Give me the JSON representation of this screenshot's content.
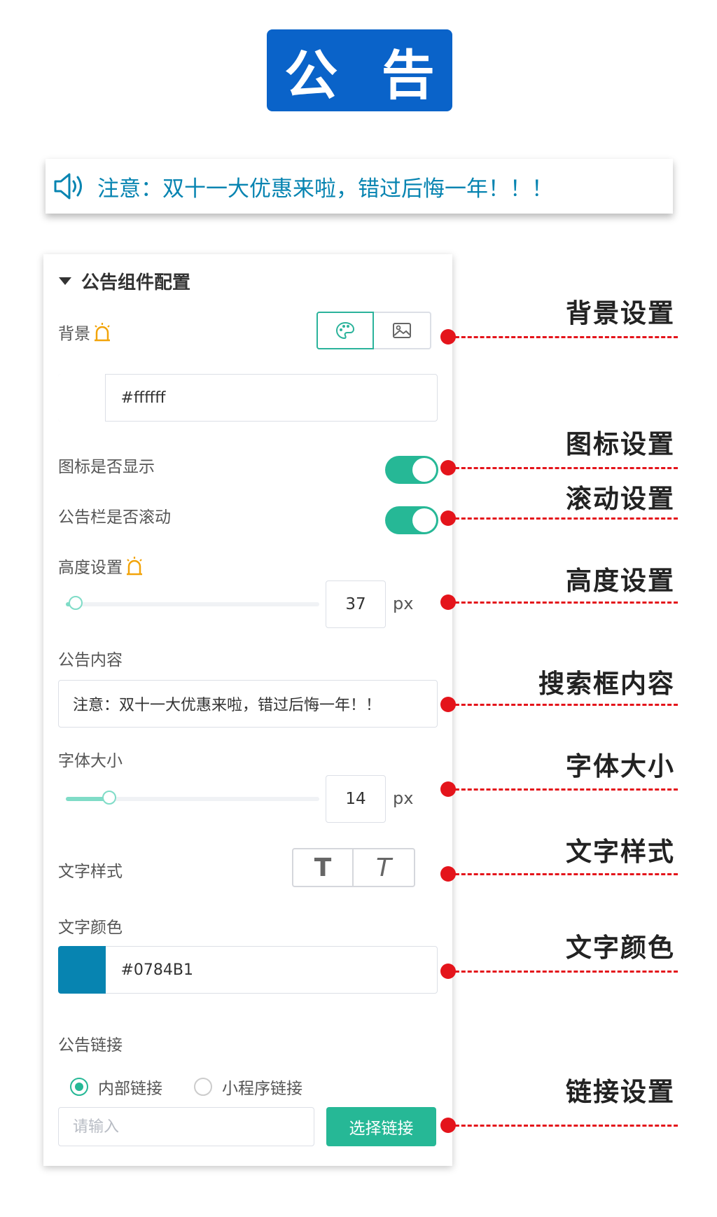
{
  "header": {
    "title": "公 告"
  },
  "notice": {
    "text": "注意：双十一大优惠来啦，错过后悔一年！！！"
  },
  "panel": {
    "title": "公告组件配置",
    "background": {
      "label": "背景",
      "color_value": "#ffffff",
      "swatch_color": "#ffffff"
    },
    "icon_show": {
      "label": "图标是否显示",
      "on": true
    },
    "scroll": {
      "label": "公告栏是否滚动",
      "on": true
    },
    "height": {
      "label": "高度设置",
      "value": "37",
      "unit": "px",
      "fraction": 0.04
    },
    "content": {
      "label": "公告内容",
      "value": "注意：双十一大优惠来啦，错过后悔一年！！"
    },
    "font_size": {
      "label": "字体大小",
      "value": "14",
      "unit": "px",
      "fraction": 0.17
    },
    "text_style": {
      "label": "文字样式",
      "bold_glyph": "T",
      "italic_glyph": "T"
    },
    "text_color": {
      "label": "文字颜色",
      "value": "#0784B1",
      "swatch_color": "#0784B1"
    },
    "link": {
      "label": "公告链接",
      "options": [
        "内部链接",
        "小程序链接"
      ],
      "selected": 0,
      "placeholder": "请输入",
      "button": "选择链接"
    }
  },
  "annotations": [
    "背景设置",
    "图标设置",
    "滚动设置",
    "高度设置",
    "搜索框内容",
    "字体大小",
    "文字样式",
    "文字颜色",
    "链接设置"
  ],
  "colors": {
    "brand_blue": "#0a63c9",
    "accent_green": "#26b896",
    "text_blue": "#0784B1",
    "annotation_red": "#e4141b"
  }
}
